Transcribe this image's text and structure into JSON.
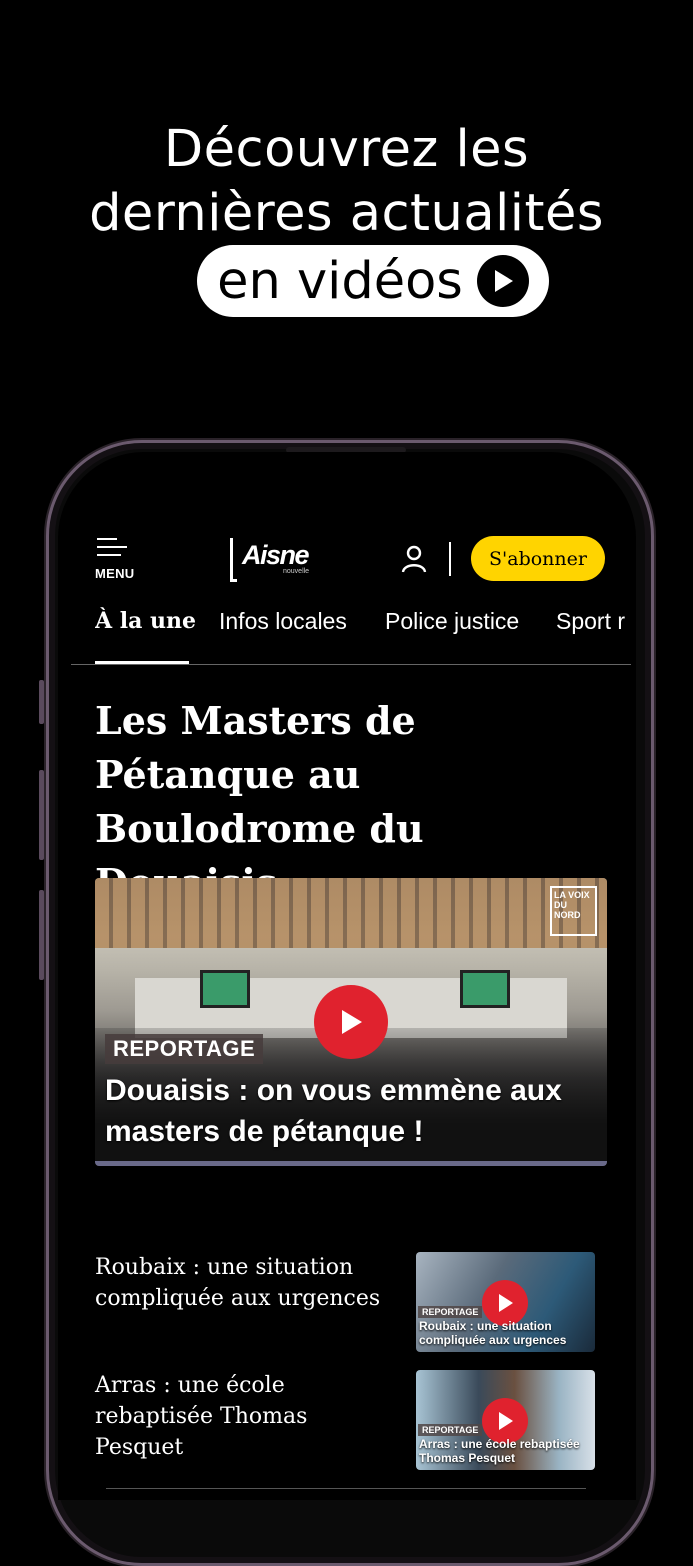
{
  "promo": {
    "line1": "Découvrez les",
    "line2": "dernières actualités",
    "pill_text": "en vidéos"
  },
  "app": {
    "menu_label": "MENU",
    "logo_name": "Aisne",
    "logo_sub": "nouvelle",
    "subscribe_label": "S'abonner",
    "accent_color": "#ffd400",
    "play_color": "#e0222e"
  },
  "nav": {
    "tabs": [
      "À la une",
      "Infos locales",
      "Police justice",
      "Sport r"
    ]
  },
  "article": {
    "title": "Les Masters de Pétanque au Boulodrome du Douaisis",
    "hero": {
      "brand": "LA VOIX DU NORD",
      "tag": "REPORTAGE",
      "caption": "Douaisis : on vous emmène aux masters de pétanque !"
    }
  },
  "items": [
    {
      "text": "Roubaix : une situation compliquée aux urgences",
      "thumb_tag": "REPORTAGE",
      "thumb_caption": "Roubaix : une situation compliquée aux urgences"
    },
    {
      "text": "Arras : une école rebaptisée Thomas Pesquet",
      "thumb_tag": "REPORTAGE",
      "thumb_caption": "Arras : une école rebaptisée Thomas Pesquet"
    }
  ]
}
